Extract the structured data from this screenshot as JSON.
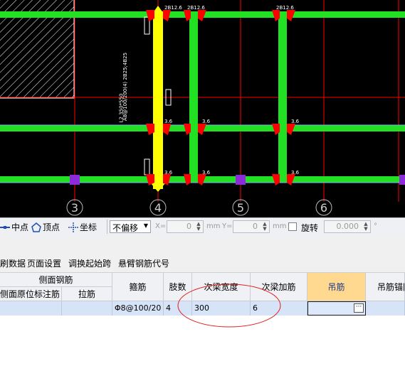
{
  "canvas": {
    "labels": {
      "top_rebar_1": "2B12.6",
      "top_rebar_2": "2B12.6",
      "top_rebar_3": "2B12.6",
      "beam_annotation_1": "L2 350*550",
      "beam_annotation_2": "A8@100/200(4) 2B25;4B25",
      "node_label": "3.6"
    },
    "axis_numbers": [
      "3",
      "4",
      "5",
      "6"
    ],
    "colors": {
      "beam": "#22e022",
      "selected_beam": "#ffff00",
      "rebar_marker": "#ff0000",
      "column": "#8b2bd9",
      "axis_line": "#ff0000"
    }
  },
  "snapbar": {
    "midpoint_label": "中点",
    "vertex_label": "顶点",
    "coordinate_label": "坐标",
    "offset_select_value": "不偏移",
    "x_label": "X=",
    "x_value": "0",
    "x_unit": "mm",
    "y_label": "Y=",
    "y_value": "0",
    "y_unit": "mm",
    "rotate_label": "旋转",
    "rotate_value": "0.000",
    "degree_unit": "°"
  },
  "menu": {
    "items": [
      "刷数据",
      "页面设置",
      "调换起始跨",
      "悬臂钢筋代号"
    ]
  },
  "table": {
    "headers": {
      "side_rebar": "侧面钢筋",
      "side_original": "侧面原位标注筋",
      "tie_bar": "拉筋",
      "stirrup": "箍筋",
      "legs": "肢数",
      "secondary_width": "次梁宽度",
      "secondary_add": "次梁加筋",
      "hanger": "吊筋",
      "hanger_anchor": "吊筋锚固"
    },
    "row": {
      "side_original": "",
      "tie_bar": "",
      "stirrup": "Φ8@100/20",
      "legs": "4",
      "secondary_width": "300",
      "secondary_add": "6",
      "hanger": "",
      "hanger_anchor": ""
    },
    "ellipsis_label": "···"
  }
}
